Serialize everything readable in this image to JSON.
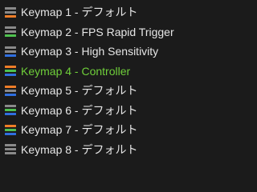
{
  "items": [
    {
      "label": "Keymap 1 - デフォルト",
      "active": false,
      "colors": [
        "#8a8a8a",
        "#8a8a8a",
        "#ee7d28"
      ]
    },
    {
      "label": "Keymap 2 - FPS Rapid Trigger",
      "active": false,
      "colors": [
        "#8a8a8a",
        "#8a8a8a",
        "#4fc24f"
      ]
    },
    {
      "label": "Keymap 3 - High Sensitivity",
      "active": false,
      "colors": [
        "#8a8a8a",
        "#8a8a8a",
        "#2f6fe0"
      ]
    },
    {
      "label": "Keymap 4 - Controller",
      "active": true,
      "colors": [
        "#ee7d28",
        "#4fc24f",
        "#2f6fe0"
      ]
    },
    {
      "label": "Keymap 5 - デフォルト",
      "active": false,
      "colors": [
        "#ee7d28",
        "#8a8a8a",
        "#2f6fe0"
      ]
    },
    {
      "label": "Keymap 6 - デフォルト",
      "active": false,
      "colors": [
        "#8a8a8a",
        "#4fc24f",
        "#2f6fe0"
      ]
    },
    {
      "label": "Keymap 7 - デフォルト",
      "active": false,
      "colors": [
        "#ee7d28",
        "#4fc24f",
        "#2f6fe0"
      ]
    },
    {
      "label": "Keymap 8 - デフォルト",
      "active": false,
      "colors": [
        "#8a8a8a",
        "#8a8a8a",
        "#8a8a8a"
      ]
    }
  ]
}
